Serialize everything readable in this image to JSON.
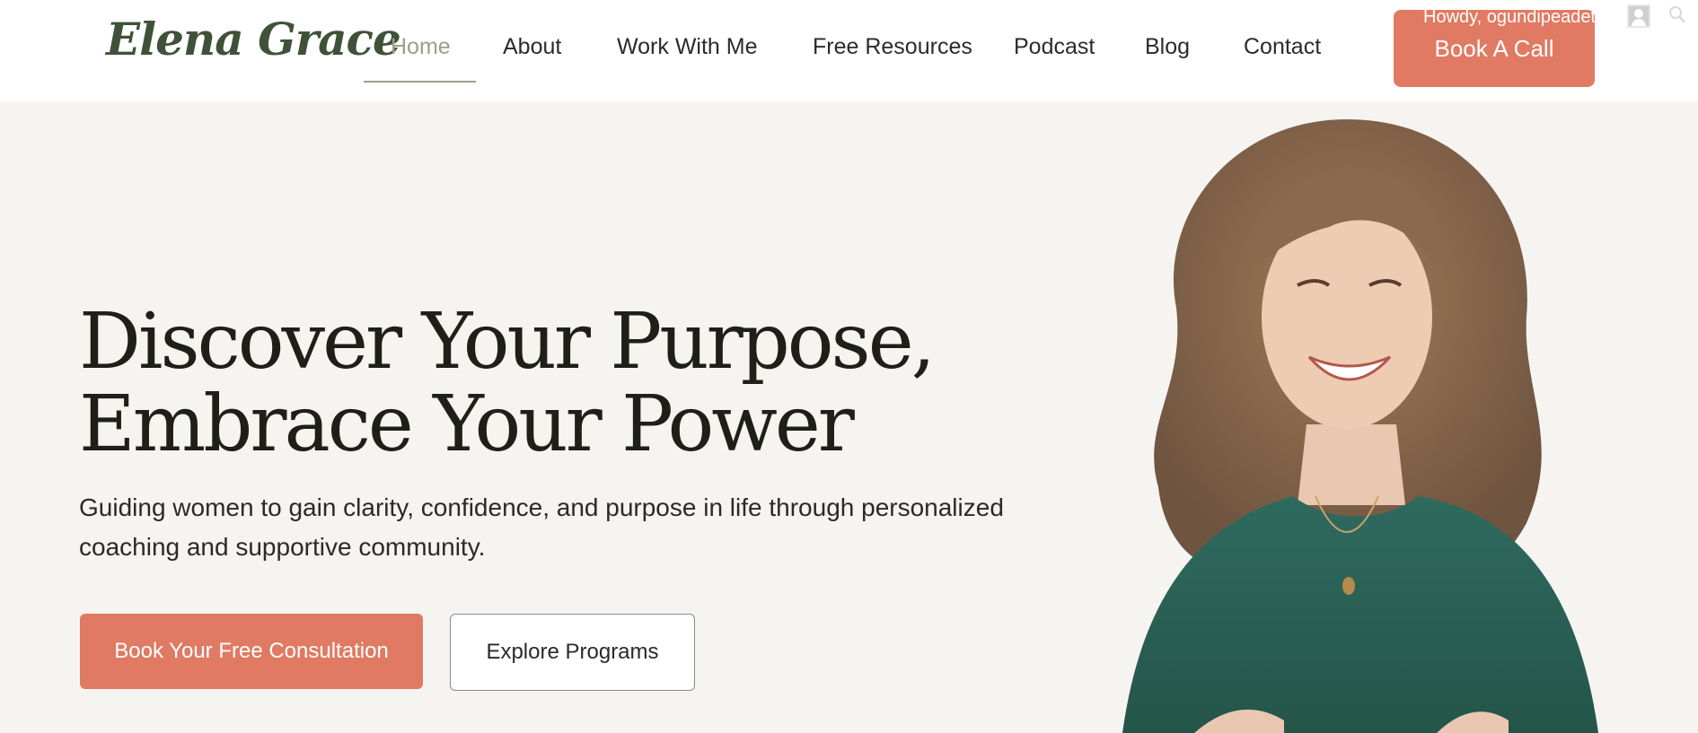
{
  "brand": {
    "logo_text": "Elena Grace"
  },
  "nav": {
    "items": [
      {
        "label": "Home",
        "active": true
      },
      {
        "label": "About"
      },
      {
        "label": "Work With Me"
      },
      {
        "label": "Free Resources"
      },
      {
        "label": "Podcast"
      },
      {
        "label": "Blog"
      },
      {
        "label": "Contact"
      }
    ],
    "cta_label": "Book A Call"
  },
  "admin_bar": {
    "greeting": "Howdy, ogundipeadetola",
    "avatar_icon": "user-avatar-icon",
    "search_icon": "search-icon"
  },
  "hero": {
    "title_line1": "Discover Your Purpose,",
    "title_line2": "Embrace Your Power",
    "subtitle": "Guiding women to gain clarity, confidence, and purpose in life through personalized coaching and supportive community.",
    "primary_button": "Book Your Free Consultation",
    "secondary_button": "Explore Programs"
  },
  "colors": {
    "accent": "#e07a63",
    "logo": "#3f5238",
    "nav_active": "#9aa08a",
    "hero_bg": "#f6f4f1",
    "dress": "#2f6a5f",
    "hair": "#8a6a4e"
  }
}
